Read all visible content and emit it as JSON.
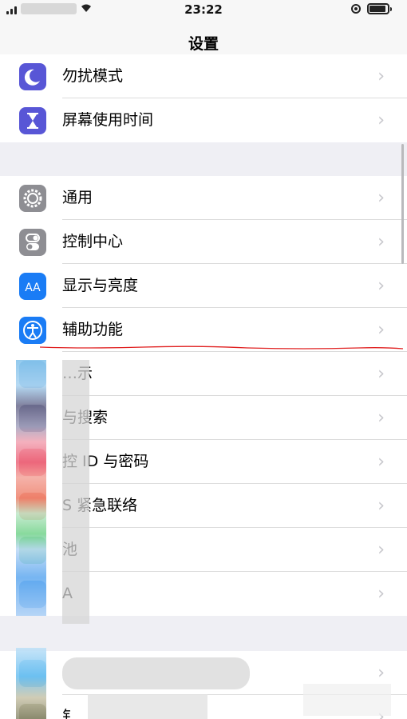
{
  "status_bar": {
    "time": "23:22"
  },
  "nav": {
    "title": "设置"
  },
  "group1": [
    {
      "label": "勿扰模式",
      "icon": "moon-icon",
      "color": "#5856d6"
    },
    {
      "label": "屏幕使用时间",
      "icon": "hourglass-icon",
      "color": "#5856d6"
    }
  ],
  "group2": [
    {
      "label": "通用",
      "icon": "gear-icon",
      "color": "#8e8e93"
    },
    {
      "label": "控制中心",
      "icon": "toggles-icon",
      "color": "#8e8e93"
    },
    {
      "label": "显示与亮度",
      "icon": "aa-icon",
      "color": "#1a7cf5"
    },
    {
      "label": "辅助功能",
      "icon": "accessibility-icon",
      "color": "#1a7cf5"
    },
    {
      "label": "…示",
      "icon": "blurred-icon",
      "color": "#7fb8e6"
    },
    {
      "label": "与搜索",
      "icon": "blurred-icon",
      "color": "#6a6a8c"
    },
    {
      "label": "控 ID 与密码",
      "icon": "blurred-icon",
      "color": "#ef6b7c"
    },
    {
      "label": "S 紧急联络",
      "icon": "blurred-icon",
      "color": "#f07e6c"
    },
    {
      "label": "池",
      "icon": "blurred-icon",
      "color": "#76d58c"
    },
    {
      "label": "A",
      "icon": "blurred-icon",
      "color": "#5ea8ef"
    }
  ],
  "group3": [
    {
      "label": "",
      "icon": "blurred-icon",
      "color": "#6cc0f1"
    },
    {
      "label": "钅",
      "icon": "blurred-icon",
      "color": "#8a8a6e"
    }
  ],
  "chevron": "›"
}
